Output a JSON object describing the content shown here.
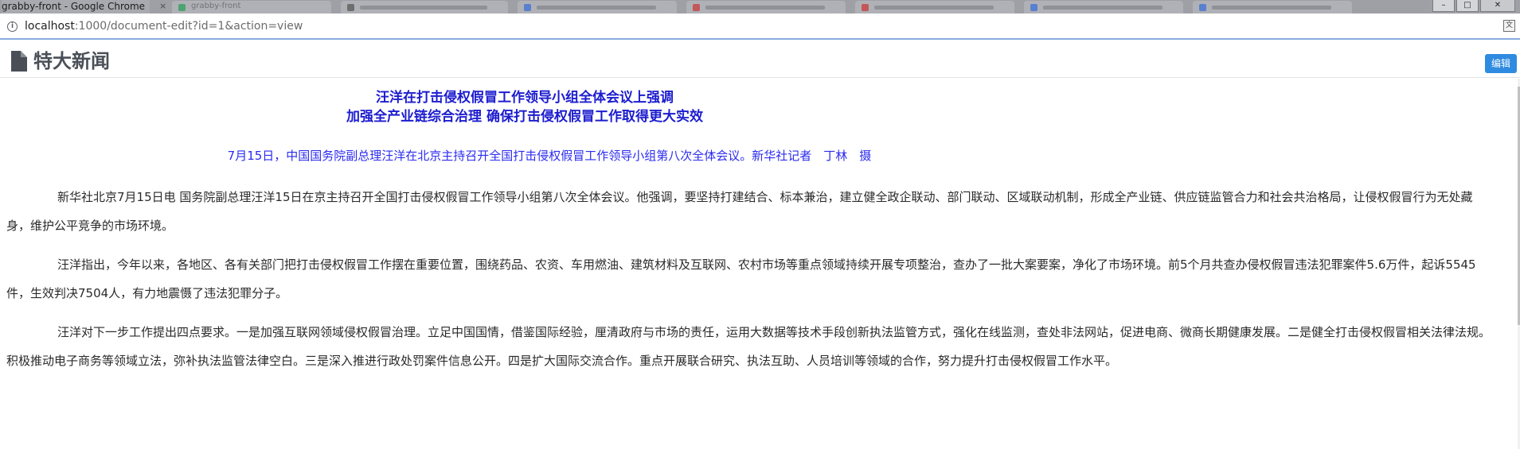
{
  "browser": {
    "window_title": "grabby-front - Google Chrome",
    "tab_title_2": "grabby-front",
    "url_host": "localhost",
    "url_path": ":1000/document-edit?id=1&action=view",
    "win_min": "–",
    "win_max": "□",
    "win_close": "✕",
    "tab_close": "×"
  },
  "header": {
    "title": "特大新闻",
    "edit_label": "编辑"
  },
  "article": {
    "headline_line1": "汪洋在打击侵权假冒工作领导小组全体会议上强调",
    "headline_line2": "加强全产业链综合治理 确保打击侵权假冒工作取得更大实效",
    "caption": "7月15日，中国国务院副总理汪洋在北京主持召开全国打击侵权假冒工作领导小组第八次全体会议。新华社记者　丁林　摄",
    "paragraphs": [
      "新华社北京7月15日电 国务院副总理汪洋15日在京主持召开全国打击侵权假冒工作领导小组第八次全体会议。他强调，要坚持打建结合、标本兼治，建立健全政企联动、部门联动、区域联动机制，形成全产业链、供应链监管合力和社会共治格局，让侵权假冒行为无处藏身，维护公平竞争的市场环境。",
      "汪洋指出，今年以来，各地区、各有关部门把打击侵权假冒工作摆在重要位置，围绕药品、农资、车用燃油、建筑材料及互联网、农村市场等重点领域持续开展专项整治，查办了一批大案要案，净化了市场环境。前5个月共查办侵权假冒违法犯罪案件5.6万件，起诉5545件，生效判决7504人，有力地震慑了违法犯罪分子。",
      "汪洋对下一步工作提出四点要求。一是加强互联网领域侵权假冒治理。立足中国国情，借鉴国际经验，厘清政府与市场的责任，运用大数据等技术手段创新执法监管方式，强化在线监测，查处非法网站，促进电商、微商长期健康发展。二是健全打击侵权假冒相关法律法规。积极推动电子商务等领域立法，弥补执法监管法律空白。三是深入推进行政处罚案件信息公开。四是扩大国际交流合作。重点开展联合研究、执法互助、人员培训等领域的合作，努力提升打击侵权假冒工作水平。"
    ]
  },
  "colors": {
    "headline": "#1c1ccf",
    "caption": "#2b2bf0",
    "edit_button": "#2f8be0",
    "title": "#4a4f57"
  }
}
